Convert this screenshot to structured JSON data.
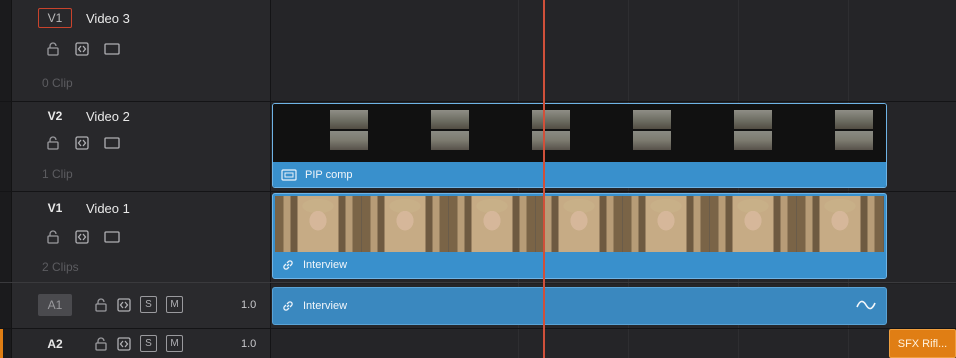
{
  "tracks": {
    "v3": {
      "patch": "V1",
      "name": "Video 3",
      "clips": "0 Clip"
    },
    "v2": {
      "patch": "V2",
      "name": "Video 2",
      "clips": "1 Clip"
    },
    "v1": {
      "patch": "V1",
      "name": "Video 1",
      "clips": "2 Clips"
    },
    "a1": {
      "patch": "A1",
      "solo": "S",
      "mute": "M",
      "volume": "1.0"
    },
    "a2": {
      "patch": "A2",
      "solo": "S",
      "mute": "M",
      "volume": "1.0"
    }
  },
  "clips": {
    "pip": {
      "label": "PIP comp"
    },
    "interview_video": {
      "label": "Interview"
    },
    "interview_audio": {
      "label": "Interview"
    },
    "sfx": {
      "label": "SFX Rifl..."
    }
  },
  "colors": {
    "playhead": "#d0503a",
    "video_clip": "#3990cc",
    "audio_clip": "#3a88bf",
    "sfx_clip": "#e07e14",
    "destination_patch_border": "#c9432c"
  },
  "icons": {
    "lock": "lock-icon",
    "auto_select": "auto-select-icon",
    "disable_video": "video-monitor-icon",
    "link": "link-icon",
    "compound": "compound-clip-icon",
    "waveform": "waveform-icon"
  }
}
